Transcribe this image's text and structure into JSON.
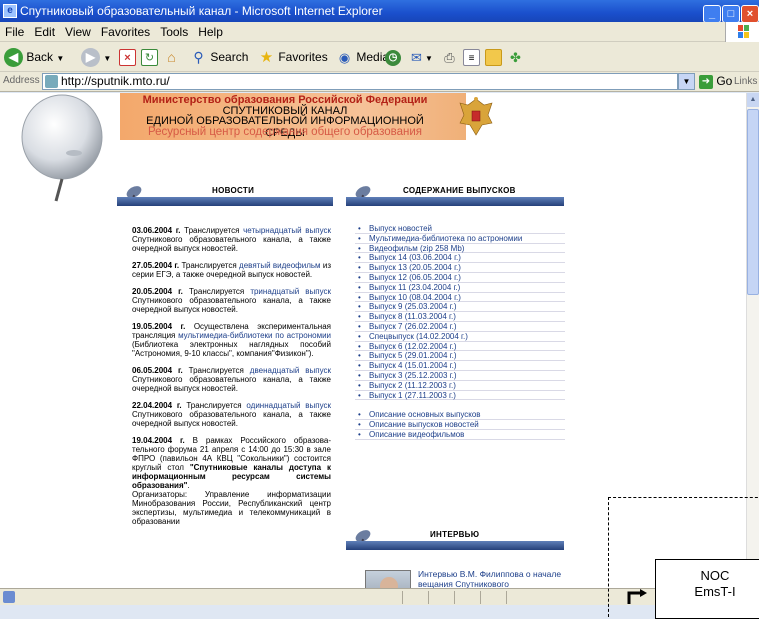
{
  "window": {
    "title": "Спутниковый образовательный канал - Microsoft Internet Explorer",
    "controls": [
      "minimize",
      "maximize",
      "close"
    ]
  },
  "menu": [
    "File",
    "Edit",
    "View",
    "Favorites",
    "Tools",
    "Help"
  ],
  "toolbar": {
    "back": "Back",
    "search": "Search",
    "favorites": "Favorites",
    "media": "Media"
  },
  "address": {
    "label": "Address",
    "url": "http://sputnik.mto.ru/",
    "go": "Go",
    "links": "Links"
  },
  "banner": {
    "line1": "Министерство образования Российской Федерации",
    "line2": "СПУТНИКОВЫЙ КАНАЛ",
    "line3": "ЕДИНОЙ ОБРАЗОВАТЕЛЬНОЙ ИНФОРМАЦИОННОЙ СРЕДЫ",
    "line4": "Ресурсный центр содержания общего образования"
  },
  "sections": {
    "news": "НОВОСТИ",
    "contents": "СОДЕРЖАНИЕ ВЫПУСКОВ",
    "interview": "ИНТЕРВЬЮ"
  },
  "news": [
    {
      "date": "03.06.2004 г.",
      "pre": " Транслируется ",
      "link": "четырнадцатый выпуск",
      "post": " Спутникового образовательного канала, а также очередной выпуск новостей."
    },
    {
      "date": "27.05.2004 г.",
      "pre": " Транслируется ",
      "link": "девятый видеофильм",
      "post": " из серии ЕГЭ, а также очередной выпуск новостей."
    },
    {
      "date": "20.05.2004 г.",
      "pre": " Транслируется ",
      "link": "тринадцатый выпуск",
      "post": " Спутникового образовательного канала, а также очередной выпуск новостей."
    },
    {
      "date": "19.05.2004 г.",
      "pre": " Осуществлена экспериментальная трансляция ",
      "link": "мультимедиа-библиотеки по астрономии",
      "post": " (Библиотека электронных наглядных пособий \"Астрономия, 9-10 классы\", компания\"Физикон\")."
    },
    {
      "date": "06.05.2004 г.",
      "pre": " Транслируется ",
      "link": "двенадцатый выпуск",
      "post": " Спутникового образовательного канала, а также очередной выпуск новостей."
    },
    {
      "date": "22.04.2004 г.",
      "pre": " Транслируется ",
      "link": "одиннадцатый выпуск",
      "post": " Спутникового образовательного канала, а также очередной выпуск новостей."
    }
  ],
  "news_last": {
    "date": "19.04.2004 г.",
    "pre": " В рамках Российского образова-тельного форума 21 апреля с 14:00 до 15:30 в зале ФПРО (павильон 4А КВЦ \"Сокольники\") состоится круглый стол ",
    "bold": "\"Спутниковые каналы доступа к информационным ресурсам системы образования\"",
    "post": ".",
    "org": "Организаторы: Управление информатизации Минобразования России, Республиканский центр экспертизы, мультимедиа и телекоммуникаций в образовании"
  },
  "toc_main": [
    "Выпуск новостей",
    "Мультимедиа-библиотека по астрономии",
    "Видеофильм (zip 258 Mb)",
    "Выпуск 14 (03.06.2004 г.)",
    "Выпуск 13 (20.05.2004 г.)",
    "Выпуск 12 (06.05.2004 г.)",
    "Выпуск 11 (23.04.2004 г.)",
    "Выпуск 10 (08.04.2004 г.)",
    "Выпуск 9 (25.03.2004 г.)",
    "Выпуск 8 (11.03.2004 г.)",
    "Выпуск 7 (26.02.2004 г.)",
    "Спецвыпуск (14.02.2004 г.)",
    "Выпуск 6 (12.02.2004 г.)",
    "Выпуск 5 (29.01.2004 г.)",
    "Выпуск 4 (15.01.2004 г.)",
    "Выпуск 3 (25.12.2003 г.)",
    "Выпуск 2 (11.12.2003 г.)",
    "Выпуск 1 (27.11.2003 г.)"
  ],
  "toc_extra": [
    "Описание основных выпусков",
    "Описание выпусков новостей",
    "Описание видеофильмов"
  ],
  "interview": {
    "text": "Интервью В.М. Филиппова о начале вещания Спутникового"
  },
  "diagram": {
    "line1": "NOC",
    "line2": "EmsT-I"
  }
}
